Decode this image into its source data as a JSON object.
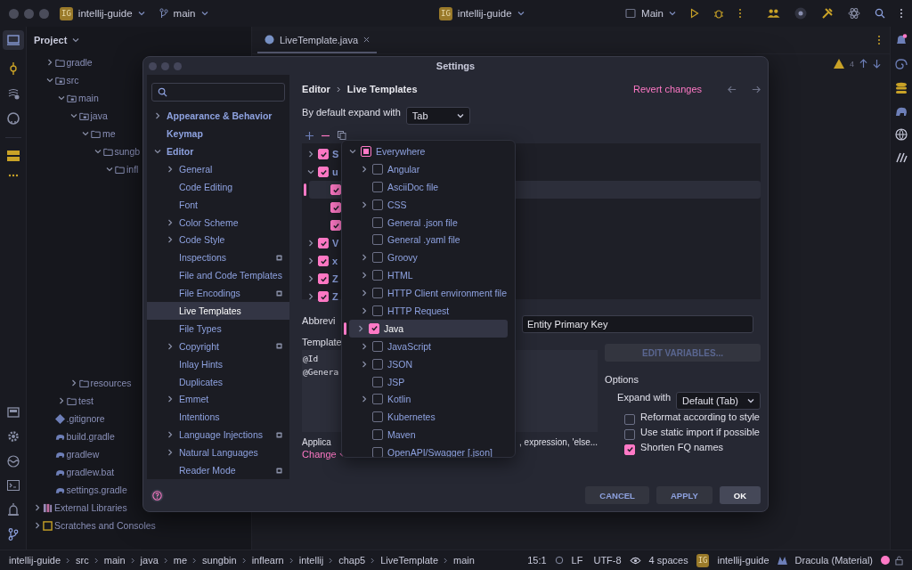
{
  "title_bar": {
    "project_badge": "IG",
    "project": "intellij-guide",
    "branch": "main",
    "center_badge": "IG",
    "center_project": "intellij-guide",
    "run_config": "Main"
  },
  "project_panel": {
    "title": "Project",
    "tree": [
      {
        "name": "gradle",
        "kind": "folder",
        "expanded": false
      },
      {
        "name": "src",
        "kind": "source-folder",
        "expanded": true,
        "children": [
          {
            "name": "main",
            "kind": "source-folder",
            "expanded": true,
            "children": [
              {
                "name": "java",
                "kind": "source-folder",
                "expanded": true,
                "children": [
                  {
                    "name": "me",
                    "kind": "folder",
                    "expanded": true,
                    "children": [
                      {
                        "name": "sungb",
                        "kind": "folder",
                        "expanded": true,
                        "children": [
                          {
                            "name": "infl",
                            "kind": "folder",
                            "expanded": true
                          }
                        ]
                      }
                    ]
                  }
                ]
              },
              {
                "name": "resources",
                "kind": "folder",
                "expanded": false
              }
            ]
          },
          {
            "name": "test",
            "kind": "folder",
            "expanded": false
          }
        ]
      },
      {
        "name": ".gitignore",
        "kind": "ignore-file"
      },
      {
        "name": "build.gradle",
        "kind": "gradle-file"
      },
      {
        "name": "gradlew",
        "kind": "gradle-file"
      },
      {
        "name": "gradlew.bat",
        "kind": "gradle-file"
      },
      {
        "name": "settings.gradle",
        "kind": "gradle-file"
      }
    ],
    "root_items": [
      {
        "name": "External Libraries",
        "kind": "library",
        "expanded": false
      },
      {
        "name": "Scratches and Consoles",
        "kind": "scratches",
        "expanded": false
      }
    ]
  },
  "editor": {
    "tab": "LiveTemplate.java",
    "warnings": "4"
  },
  "settings": {
    "title": "Settings",
    "nav": [
      {
        "label": "Appearance & Behavior",
        "expanded": false,
        "selected": false
      },
      {
        "label": "Keymap",
        "selected": false
      },
      {
        "label": "Editor",
        "expanded": true,
        "selected": false,
        "children": [
          {
            "label": "General",
            "expanded": false,
            "selected": false
          },
          {
            "label": "Code Editing",
            "selected": false
          },
          {
            "label": "Font",
            "selected": false
          },
          {
            "label": "Color Scheme",
            "expanded": false,
            "selected": false
          },
          {
            "label": "Code Style",
            "expanded": false,
            "selected": false
          },
          {
            "label": "Inspections",
            "project_level": true,
            "selected": false
          },
          {
            "label": "File and Code Templates",
            "selected": false
          },
          {
            "label": "File Encodings",
            "project_level": true,
            "selected": false
          },
          {
            "label": "Live Templates",
            "selected": true
          },
          {
            "label": "File Types",
            "selected": false
          },
          {
            "label": "Copyright",
            "expanded": false,
            "project_level": true,
            "selected": false
          },
          {
            "label": "Inlay Hints",
            "selected": false
          },
          {
            "label": "Duplicates",
            "selected": false
          },
          {
            "label": "Emmet",
            "expanded": false,
            "selected": false
          },
          {
            "label": "Intentions",
            "selected": false
          },
          {
            "label": "Language Injections",
            "expanded": false,
            "project_level": true,
            "selected": false
          },
          {
            "label": "Natural Languages",
            "expanded": false,
            "selected": false
          },
          {
            "label": "Reader Mode",
            "project_level": true,
            "selected": false
          }
        ]
      }
    ],
    "breadcrumb": [
      "Editor",
      "Live Templates"
    ],
    "revert": "Revert changes",
    "expand_default": {
      "label": "By default expand with",
      "value": "Tab"
    },
    "template_groups": [
      {
        "label": "S",
        "checked": true,
        "expanded": false
      },
      {
        "label": "u",
        "checked": true,
        "expanded": true,
        "children": [
          {
            "checked": true,
            "selected": true
          },
          {
            "checked": true,
            "selected": false
          },
          {
            "checked": true,
            "selected": false
          }
        ]
      },
      {
        "label": "V",
        "checked": true,
        "expanded": false
      },
      {
        "label": "x",
        "checked": true,
        "expanded": false
      },
      {
        "label": "Z",
        "checked": true,
        "expanded": false
      },
      {
        "label": "Z",
        "checked": true,
        "expanded": false
      }
    ],
    "abbreviation_label": "Abbrevi",
    "description": "Entity Primary Key",
    "template_label": "Template",
    "template_lines": [
      "@Id",
      "@Genera"
    ],
    "edit_variables": {
      "label": "EDIT VARIABLES...",
      "disabled": true
    },
    "options": {
      "title": "Options",
      "expand_label": "Expand with",
      "expand_value": "Default (Tab)",
      "checks": [
        {
          "label": "Reformat according to style",
          "checked": false
        },
        {
          "label": "Use static import if possible",
          "checked": false
        },
        {
          "label": "Shorten FQ names",
          "checked": true
        }
      ]
    },
    "applicable_label": "Applica",
    "applicable_text": ", expression, 'else...",
    "change": "Change",
    "buttons": [
      {
        "label": "CANCEL",
        "kind": "plain"
      },
      {
        "label": "APPLY",
        "kind": "plain"
      },
      {
        "label": "OK",
        "kind": "default"
      }
    ],
    "contexts": [
      {
        "label": "Everywhere",
        "mixed": true,
        "expanded": true,
        "selected": false,
        "children": [
          {
            "label": "Angular",
            "checked": false,
            "expanded": false,
            "selected": false
          },
          {
            "label": "AsciiDoc file",
            "checked": false,
            "selected": false
          },
          {
            "label": "CSS",
            "checked": false,
            "expanded": false,
            "selected": false
          },
          {
            "label": "General .json file",
            "checked": false,
            "selected": false
          },
          {
            "label": "General .yaml file",
            "checked": false,
            "selected": false
          },
          {
            "label": "Groovy",
            "checked": false,
            "expanded": false,
            "selected": false
          },
          {
            "label": "HTML",
            "checked": false,
            "expanded": false,
            "selected": false
          },
          {
            "label": "HTTP Client environment file",
            "checked": false,
            "expanded": false,
            "selected": false
          },
          {
            "label": "HTTP Request",
            "checked": false,
            "expanded": false,
            "selected": false
          },
          {
            "label": "Java",
            "checked": true,
            "expanded": false,
            "selected": true
          },
          {
            "label": "JavaScript",
            "checked": false,
            "expanded": false,
            "selected": false
          },
          {
            "label": "JSON",
            "checked": false,
            "expanded": false,
            "selected": false
          },
          {
            "label": "JSP",
            "checked": false,
            "selected": false
          },
          {
            "label": "Kotlin",
            "checked": false,
            "expanded": false,
            "selected": false
          },
          {
            "label": "Kubernetes",
            "checked": false,
            "selected": false
          },
          {
            "label": "Maven",
            "checked": false,
            "selected": false
          },
          {
            "label": "OpenAPI/Swagger [.json]",
            "checked": false,
            "selected": false
          }
        ]
      }
    ]
  },
  "status_bar": {
    "path": [
      "intellij-guide",
      "src",
      "main",
      "java",
      "me",
      "sungbin",
      "inflearn",
      "intellij",
      "chap5",
      "LiveTemplate",
      "main"
    ],
    "position": "15:1",
    "line_ending": "LF",
    "encoding": "UTF-8",
    "indent": "4 spaces",
    "project_badge": "IG",
    "project": "intellij-guide",
    "theme": "Dracula (Material)"
  }
}
